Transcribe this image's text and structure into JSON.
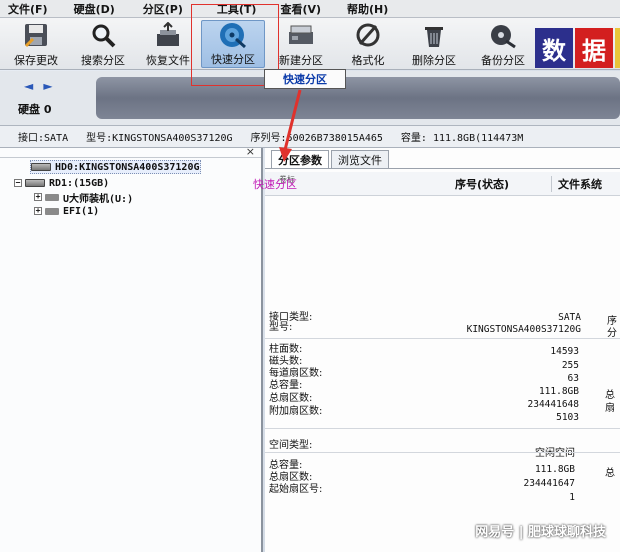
{
  "menu": [
    "文件(F)",
    "硬盘(D)",
    "分区(P)",
    "工具(T)",
    "查看(V)",
    "帮助(H)"
  ],
  "toolbar": [
    {
      "label": "保存更改",
      "icon": "save-disk-icon"
    },
    {
      "label": "搜索分区",
      "icon": "magnifier-icon"
    },
    {
      "label": "恢复文件",
      "icon": "restore-files-icon"
    },
    {
      "label": "快速分区",
      "icon": "quick-partition-disk-icon"
    },
    {
      "label": "新建分区",
      "icon": "new-partition-icon"
    },
    {
      "label": "格式化",
      "icon": "format-icon"
    },
    {
      "label": "删除分区",
      "icon": "trash-icon"
    },
    {
      "label": "备份分区",
      "icon": "backup-disc-icon"
    }
  ],
  "brand": {
    "char1": "数",
    "char2": "据"
  },
  "tooltip": "快速分区",
  "disk_bar": {
    "arrows": "◄ ►",
    "label": "硬盘 0"
  },
  "disk_info": {
    "interface": "接口:SATA",
    "model": "型号:KINGSTONSA400S37120G",
    "serial": "序列号:50026B738015A465",
    "capacity": "容量: 111.8GB(114473M"
  },
  "tree": [
    {
      "text": "HD0:KINGSTONSA400S37120G"
    },
    {
      "text": "RD1:(15GB)"
    },
    {
      "text": "U大师装机(U:)"
    },
    {
      "text": "EFI(1)"
    }
  ],
  "tabs": [
    "分区参数",
    "浏览文件"
  ],
  "overlay_note": "快速分区",
  "columns": {
    "small": "卷标",
    "status": "序号(状态)",
    "fs": "文件系统"
  },
  "props_top": [
    {
      "label": "接口类型:",
      "value": "SATA",
      "extra": "序"
    },
    {
      "label": "型号:",
      "value": "KINGSTONSA400S37120G",
      "extra": "分"
    }
  ],
  "props_mid": [
    {
      "label": "柱面数:",
      "value": "14593",
      "extra": ""
    },
    {
      "label": "磁头数:",
      "value": "255",
      "extra": ""
    },
    {
      "label": "每道扇区数:",
      "value": "63",
      "extra": ""
    },
    {
      "label": "总容量:",
      "value": "111.8GB",
      "extra": "总"
    },
    {
      "label": "总扇区数:",
      "value": "234441648",
      "extra": "扇"
    },
    {
      "label": "附加扇区数:",
      "value": "5103",
      "extra": ""
    }
  ],
  "space": {
    "label": "空间类型:",
    "value": "空闲空间"
  },
  "props_bottom": [
    {
      "label": "总容量:",
      "value": "111.8GB",
      "extra": "总"
    },
    {
      "label": "总扇区数:",
      "value": "234441647",
      "extra": ""
    },
    {
      "label": "起始扇区号:",
      "value": "1",
      "extra": ""
    }
  ],
  "watermark": "网易号 | 肥球球聊科技",
  "colors": {
    "highlight": "#e0322d",
    "tooltip_text": "#0a3aa9",
    "note": "#c11ab6"
  }
}
